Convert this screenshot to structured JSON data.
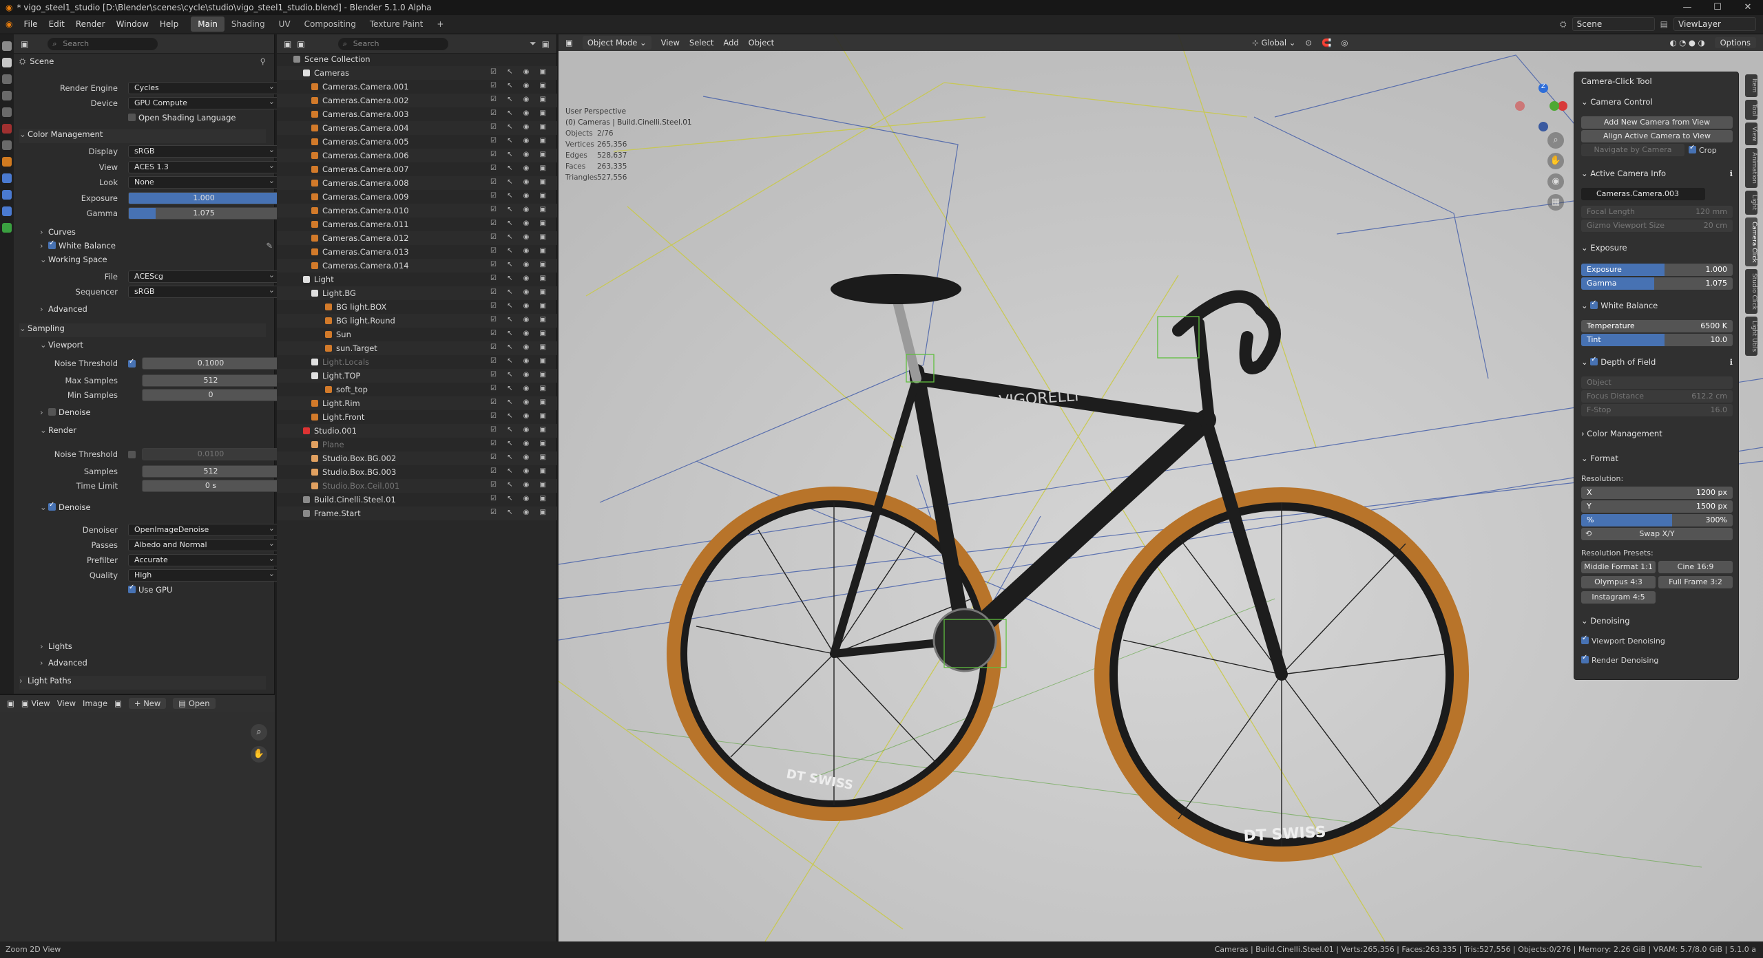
{
  "title": "* vigo_steel1_studio [D:\\Blender\\scenes\\cycle\\studio\\vigo_steel1_studio.blend] - Blender 5.1.0 Alpha",
  "menu": [
    "File",
    "Edit",
    "Render",
    "Window",
    "Help"
  ],
  "workspaces": [
    "Main",
    "Shading",
    "UV",
    "Compositing",
    "Texture Paint",
    "+"
  ],
  "scene_field": "Scene",
  "viewlayer_field": "ViewLayer",
  "props": {
    "search": "Search",
    "header": "Scene",
    "render_engine_label": "Render Engine",
    "render_engine": "Cycles",
    "device_label": "Device",
    "device": "GPU Compute",
    "osl": "Open Shading Language",
    "color_mgmt": "Color Management",
    "display_label": "Display",
    "display": "sRGB",
    "view_label": "View",
    "view": "ACES 1.3",
    "look_label": "Look",
    "look": "None",
    "exposure_label": "Exposure",
    "exposure": "1.000",
    "gamma_label": "Gamma",
    "gamma": "1.075",
    "curves": "Curves",
    "white_balance": "White Balance",
    "working_space": "Working Space",
    "file_label": "File",
    "file": "ACEScg",
    "sequencer_label": "Sequencer",
    "sequencer": "sRGB",
    "advanced": "Advanced",
    "sampling": "Sampling",
    "viewport": "Viewport",
    "noise_threshold_label": "Noise Threshold",
    "vp_noise": "0.1000",
    "max_samples_label": "Max Samples",
    "vp_max": "512",
    "min_samples_label": "Min Samples",
    "vp_min": "0",
    "denoise": "Denoise",
    "render": "Render",
    "r_noise": "0.0100",
    "samples_label": "Samples",
    "r_samples": "512",
    "time_limit_label": "Time Limit",
    "r_time": "0 s",
    "denoiser_label": "Denoiser",
    "denoiser": "OpenImageDenoise",
    "passes_label": "Passes",
    "passes": "Albedo and Normal",
    "prefilter_label": "Prefilter",
    "prefilter": "Accurate",
    "quality_label": "Quality",
    "quality": "High",
    "use_gpu": "Use GPU",
    "lights": "Lights",
    "advanced2": "Advanced",
    "light_paths": "Light Paths"
  },
  "image_editor": {
    "view": "View",
    "view2": "View",
    "image": "Image",
    "new": "New",
    "open": "Open"
  },
  "outliner": {
    "search": "Search",
    "rows": [
      "Scene Collection",
      "Cameras",
      "Cameras.Camera.001",
      "Cameras.Camera.002",
      "Cameras.Camera.003",
      "Cameras.Camera.004",
      "Cameras.Camera.005",
      "Cameras.Camera.006",
      "Cameras.Camera.007",
      "Cameras.Camera.008",
      "Cameras.Camera.009",
      "Cameras.Camera.010",
      "Cameras.Camera.011",
      "Cameras.Camera.012",
      "Cameras.Camera.013",
      "Cameras.Camera.014",
      "Light",
      "Light.BG",
      "BG light.BOX",
      "BG light.Round",
      "Sun",
      "sun.Target",
      "Light.Locals",
      "Light.TOP",
      "soft_top",
      "Light.Rim",
      "Light.Front",
      "Studio.001",
      "Plane",
      "Studio.Box.BG.002",
      "Studio.Box.BG.003",
      "Studio.Box.Ceil.001",
      "Build.Cinelli.Steel.01",
      "Frame.Start"
    ]
  },
  "viewport": {
    "mode": "Object Mode",
    "menus": [
      "View",
      "Select",
      "Add",
      "Object"
    ],
    "orientation": "Global",
    "options": "Options",
    "persp": "User Perspective",
    "coll": "(0) Cameras | Build.Cinelli.Steel.01",
    "stats": [
      [
        "Objects",
        "2/76"
      ],
      [
        "Vertices",
        "265,356"
      ],
      [
        "Edges",
        "528,637"
      ],
      [
        "Faces",
        "263,335"
      ],
      [
        "Triangles",
        "527,556"
      ]
    ],
    "brand1": "VIGORELLI",
    "brand2": "DT SWISS",
    "brand3": "DT SWISS"
  },
  "npanel": {
    "title": "Camera-Click Tool",
    "cam_control": "Camera Control",
    "add_cam": "Add New Camera from View",
    "align_cam": "Align Active Camera to View",
    "nav": "Navigate by Camera",
    "crop": "Crop",
    "active_info": "Active Camera Info",
    "active_cam": "Cameras.Camera.003",
    "focal": "Focal Length",
    "focal_v": "120 mm",
    "gizmo": "Gizmo Viewport Size",
    "gizmo_v": "20 cm",
    "exposure_h": "Exposure",
    "exposure": "Exposure",
    "exposure_v": "1.000",
    "gamma": "Gamma",
    "gamma_v": "1.075",
    "wb_h": "White Balance",
    "temp": "Temperature",
    "temp_v": "6500 K",
    "tint": "Tint",
    "tint_v": "10.0",
    "dof_h": "Depth of Field",
    "object": "Object",
    "focus": "Focus Distance",
    "focus_v": "612.2 cm",
    "fstop": "F-Stop",
    "fstop_v": "16.0",
    "cm_h": "Color Management",
    "format_h": "Format",
    "resolution": "Resolution:",
    "x": "X",
    "x_v": "1200 px",
    "y": "Y",
    "y_v": "1500 px",
    "pct": "%",
    "pct_v": "300%",
    "swap": "Swap X/Y",
    "presets": "Resolution Presets:",
    "p1": "Middle Format 1:1",
    "p2": "Cine 16:9",
    "p3": "Olympus 4:3",
    "p4": "Full Frame 3:2",
    "p5": "Instagram 4:5",
    "den_h": "Denoising",
    "vp_den": "Viewport Denoising",
    "r_den": "Render Denoising",
    "tabs": [
      "Item",
      "Tool",
      "View",
      "Animation",
      "Light",
      "Camera Click",
      "Studio Click",
      "Light Utils"
    ]
  },
  "status_left": "Zoom 2D View",
  "status_right": "Cameras | Build.Cinelli.Steel.01 | Verts:265,356 | Faces:263,335 | Tris:527,556 | Objects:0/276 | Memory: 2.26 GiB | VRAM: 5.7/8.0 GiB | 5.1.0 a"
}
